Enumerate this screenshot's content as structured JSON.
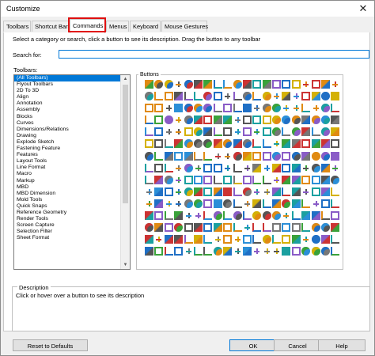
{
  "window": {
    "title": "Customize",
    "close_glyph": "✕"
  },
  "tabs": [
    "Toolbars",
    "Shortcut Bars",
    "Commands",
    "Menus",
    "Keyboard",
    "Mouse Gestures"
  ],
  "active_tab": "Commands",
  "highlight_color": "#e01010",
  "instructions": "Select a category or search, click a button to see its description. Drag the button to any toolbar",
  "search": {
    "label": "Search for:",
    "value": ""
  },
  "toolbars": {
    "label": "Toolbars:",
    "selected": "(All Toolbars)",
    "items": [
      "(All Toolbars)",
      "Flyout Toolbars",
      "2D To 3D",
      "Align",
      "Annotation",
      "Assembly",
      "Blocks",
      "Curves",
      "Dimensions/Relations",
      "Drawing",
      "Explode Sketch",
      "Fastening Feature",
      "Features",
      "Layout Tools",
      "Line Format",
      "Macro",
      "Markup",
      "MBD",
      "MBD Dimension",
      "Mold Tools",
      "Quick Snaps",
      "Reference Geometry",
      "Render Tools",
      "Screen Capture",
      "Selection Filter",
      "Sheet Format"
    ]
  },
  "buttons_group": {
    "label": "Buttons",
    "icon_name": "command-button-icon"
  },
  "description": {
    "label": "Description",
    "text": "Click or hover over a button to see its description"
  },
  "footer": {
    "reset": "Reset to Defaults",
    "ok": "OK",
    "cancel": "Cancel",
    "help": "Help"
  },
  "accent_color": "#0078d7"
}
